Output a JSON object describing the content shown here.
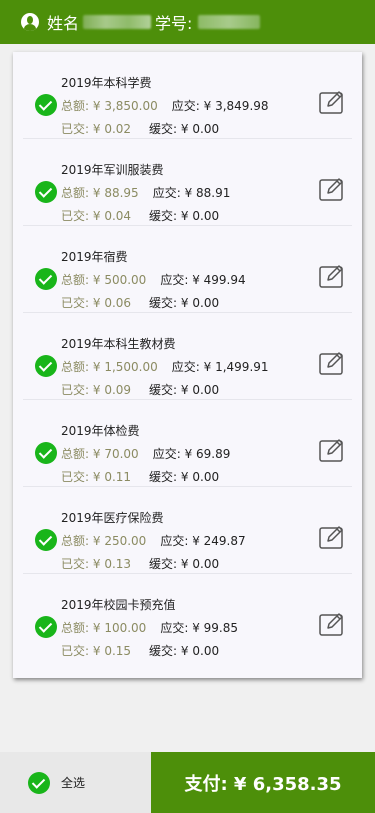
{
  "header": {
    "name_label": "姓名",
    "id_label": "学号:"
  },
  "fees": [
    {
      "name": "2019年本科学费",
      "total_label": "总额:",
      "total": "¥ 3,850.00",
      "due_label": "应交:",
      "due": "¥ 3,849.98",
      "paid_label": "已交:",
      "paid": "¥ 0.02",
      "deferred_label": "缓交:",
      "deferred": "¥ 0.00"
    },
    {
      "name": "2019年军训服装费",
      "total_label": "总额:",
      "total": "¥ 88.95",
      "due_label": "应交:",
      "due": "¥ 88.91",
      "paid_label": "已交:",
      "paid": "¥ 0.04",
      "deferred_label": "缓交:",
      "deferred": "¥ 0.00"
    },
    {
      "name": "2019年宿费",
      "total_label": "总额:",
      "total": "¥ 500.00",
      "due_label": "应交:",
      "due": "¥ 499.94",
      "paid_label": "已交:",
      "paid": "¥ 0.06",
      "deferred_label": "缓交:",
      "deferred": "¥ 0.00"
    },
    {
      "name": "2019年本科生教材费",
      "total_label": "总额:",
      "total": "¥ 1,500.00",
      "due_label": "应交:",
      "due": "¥ 1,499.91",
      "paid_label": "已交:",
      "paid": "¥ 0.09",
      "deferred_label": "缓交:",
      "deferred": "¥ 0.00"
    },
    {
      "name": "2019年体检费",
      "total_label": "总额:",
      "total": "¥ 70.00",
      "due_label": "应交:",
      "due": "¥ 69.89",
      "paid_label": "已交:",
      "paid": "¥ 0.11",
      "deferred_label": "缓交:",
      "deferred": "¥ 0.00"
    },
    {
      "name": "2019年医疗保险费",
      "total_label": "总额:",
      "total": "¥ 250.00",
      "due_label": "应交:",
      "due": "¥ 249.87",
      "paid_label": "已交:",
      "paid": "¥ 0.13",
      "deferred_label": "缓交:",
      "deferred": "¥ 0.00"
    },
    {
      "name": "2019年校园卡预充值",
      "total_label": "总额:",
      "total": "¥ 100.00",
      "due_label": "应交:",
      "due": "¥ 99.85",
      "paid_label": "已交:",
      "paid": "¥ 0.15",
      "deferred_label": "缓交:",
      "deferred": "¥ 0.00"
    }
  ],
  "footer": {
    "select_all_label": "全选",
    "pay_label": "支付: ¥ 6,358.35"
  },
  "colors": {
    "brand_green": "#4d8f0a",
    "check_green": "#19b51a"
  },
  "icons": {
    "avatar": "avatar-icon",
    "check": "check-circle-icon",
    "edit": "edit-icon"
  }
}
